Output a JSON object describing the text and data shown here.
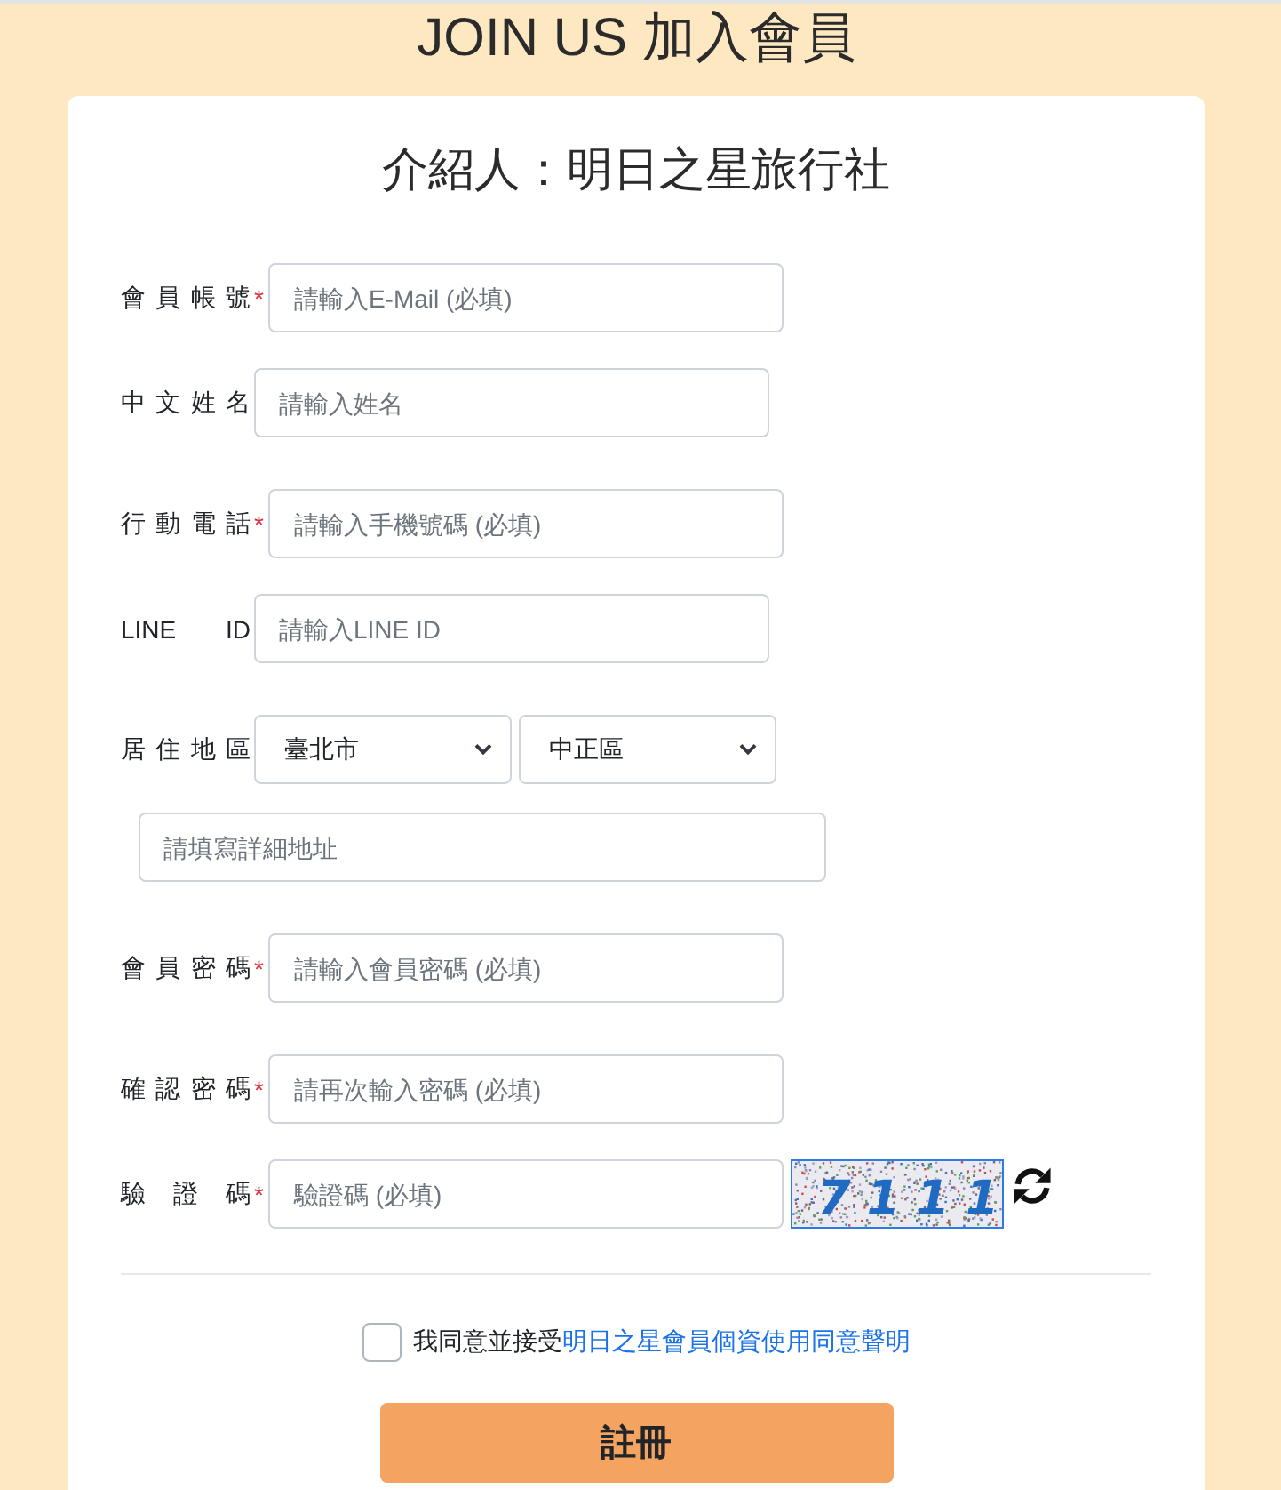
{
  "header": {
    "title": "JOIN US 加入會員"
  },
  "form": {
    "heading": "介紹人：明日之星旅行社",
    "groups": [
      {
        "fields": [
          {
            "kind": "text",
            "label": "會員帳號",
            "mark": "*",
            "placeholder": "請輸入E-Mail (必填)"
          },
          {
            "kind": "text",
            "label": "中文姓名",
            "placeholder": "請輸入姓名"
          }
        ]
      },
      {
        "fields": [
          {
            "kind": "text",
            "label": "行動電話",
            "mark": "*",
            "placeholder": "請輸入手機號碼 (必填)"
          },
          {
            "kind": "text",
            "label": "LINE ID",
            "placeholder": "請輸入LINE ID"
          }
        ]
      },
      {
        "fields": [
          {
            "kind": "selects",
            "label": "居住地區",
            "options": [
              {
                "value": "臺北市"
              },
              {
                "value": "中正區"
              }
            ]
          },
          {
            "kind": "address",
            "placeholder": "請填寫詳細地址"
          }
        ]
      },
      {
        "fields": [
          {
            "kind": "text",
            "label": "會員密碼",
            "mark": "*",
            "placeholder": "請輸入會員密碼 (必填)"
          }
        ]
      },
      {
        "fields": [
          {
            "kind": "text",
            "label": "確認密碼",
            "mark": "*",
            "placeholder": "請再次輸入密碼 (必填)"
          },
          {
            "kind": "captcha",
            "label": "驗證碼",
            "mark": "*",
            "placeholder": "驗證碼 (必填)",
            "code": "7111"
          }
        ]
      }
    ],
    "agreement": {
      "checked": false,
      "text": "我同意並接受",
      "link": "明日之星會員個資使用同意聲明"
    },
    "submit": "註冊"
  }
}
